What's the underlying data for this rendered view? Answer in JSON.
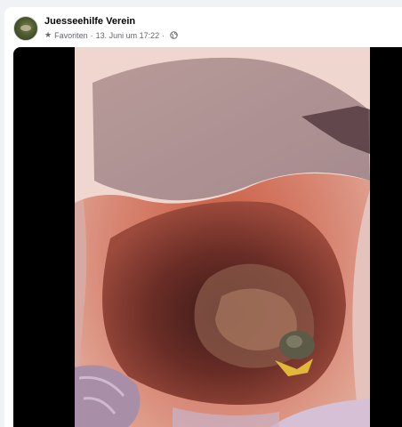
{
  "post": {
    "author": "Juesseehilfe Verein",
    "audience_icon": "star-icon",
    "audience_label": "Favoriten",
    "separator": "·",
    "date": "13. Juni um 17:22",
    "privacy_icon": "globe-icon"
  },
  "colors": {
    "page_background": "#f0f2f5",
    "card_background": "#ffffff",
    "secondary_text": "#65676b",
    "media_background": "#000000"
  }
}
